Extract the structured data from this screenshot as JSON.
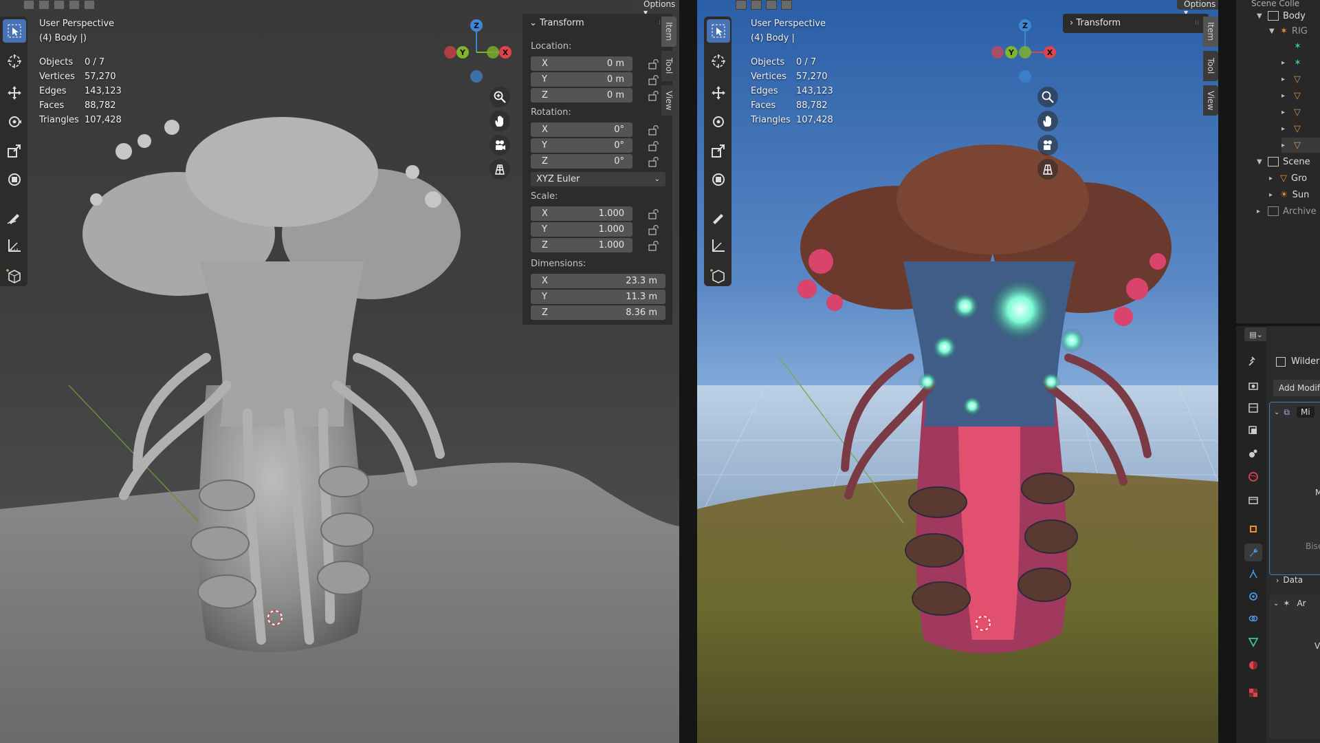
{
  "header": {
    "options_label": "Options"
  },
  "left_viewport": {
    "view_name": "User Perspective",
    "object_name": "(4) Body |)",
    "stats": [
      {
        "label": "Objects",
        "value": "0 / 7"
      },
      {
        "label": "Vertices",
        "value": "57,270"
      },
      {
        "label": "Edges",
        "value": "143,123"
      },
      {
        "label": "Faces",
        "value": "88,782"
      },
      {
        "label": "Triangles",
        "value": "107,428"
      }
    ],
    "shading": "solid"
  },
  "right_viewport": {
    "view_name": "User Perspective",
    "object_name": "(4) Body |",
    "stats": [
      {
        "label": "Objects",
        "value": "0 / 7"
      },
      {
        "label": "Vertices",
        "value": "57,270"
      },
      {
        "label": "Edges",
        "value": "143,123"
      },
      {
        "label": "Faces",
        "value": "88,782"
      },
      {
        "label": "Triangles",
        "value": "107,428"
      }
    ],
    "shading": "rendered"
  },
  "gizmo": {
    "axis_x": "X",
    "axis_y": "Y",
    "axis_z": "Z"
  },
  "toolbar": {
    "tools": [
      "select-box-icon",
      "cursor-icon",
      "move-icon",
      "rotate-icon",
      "scale-icon",
      "transform-icon",
      "annotate-icon",
      "measure-icon",
      "add-cube-icon"
    ]
  },
  "transform_panel": {
    "title": "Transform",
    "location_label": "Location:",
    "location": [
      {
        "axis": "X",
        "value": "0 m"
      },
      {
        "axis": "Y",
        "value": "0 m"
      },
      {
        "axis": "Z",
        "value": "0 m"
      }
    ],
    "rotation_label": "Rotation:",
    "rotation": [
      {
        "axis": "X",
        "value": "0°"
      },
      {
        "axis": "Y",
        "value": "0°"
      },
      {
        "axis": "Z",
        "value": "0°"
      }
    ],
    "rotation_mode": "XYZ Euler",
    "scale_label": "Scale:",
    "scale": [
      {
        "axis": "X",
        "value": "1.000"
      },
      {
        "axis": "Y",
        "value": "1.000"
      },
      {
        "axis": "Z",
        "value": "1.000"
      }
    ],
    "dimensions_label": "Dimensions:",
    "dimensions": [
      {
        "axis": "X",
        "value": "23.3 m"
      },
      {
        "axis": "Y",
        "value": "11.3 m"
      },
      {
        "axis": "Z",
        "value": "8.36 m"
      }
    ]
  },
  "right_transform_panel": {
    "title": "Transform"
  },
  "sidebar_tabs": [
    "Item",
    "Tool",
    "View"
  ],
  "outliner": {
    "top_label": "Scene Colle",
    "items": [
      {
        "label": "Body",
        "expanded": true
      },
      {
        "label": "RIG"
      },
      {
        "label": "Scene",
        "expanded": true
      },
      {
        "label": "Gro"
      },
      {
        "label": "Sun"
      },
      {
        "label": "Archive"
      }
    ]
  },
  "properties": {
    "object_name": "Wilderne",
    "add_modifier_label": "Add Modifie",
    "modifier_1_name": "Mi",
    "modifier_1_field": "Mi",
    "bisect_label": "Bise",
    "data_label": "Data",
    "modifier_2_name": "Ar",
    "modifier_2_field": "Ve"
  },
  "colors": {
    "accent": "#4772b3",
    "axis_x": "#e0434a",
    "axis_y": "#80b52b",
    "axis_z": "#3d87d6"
  }
}
